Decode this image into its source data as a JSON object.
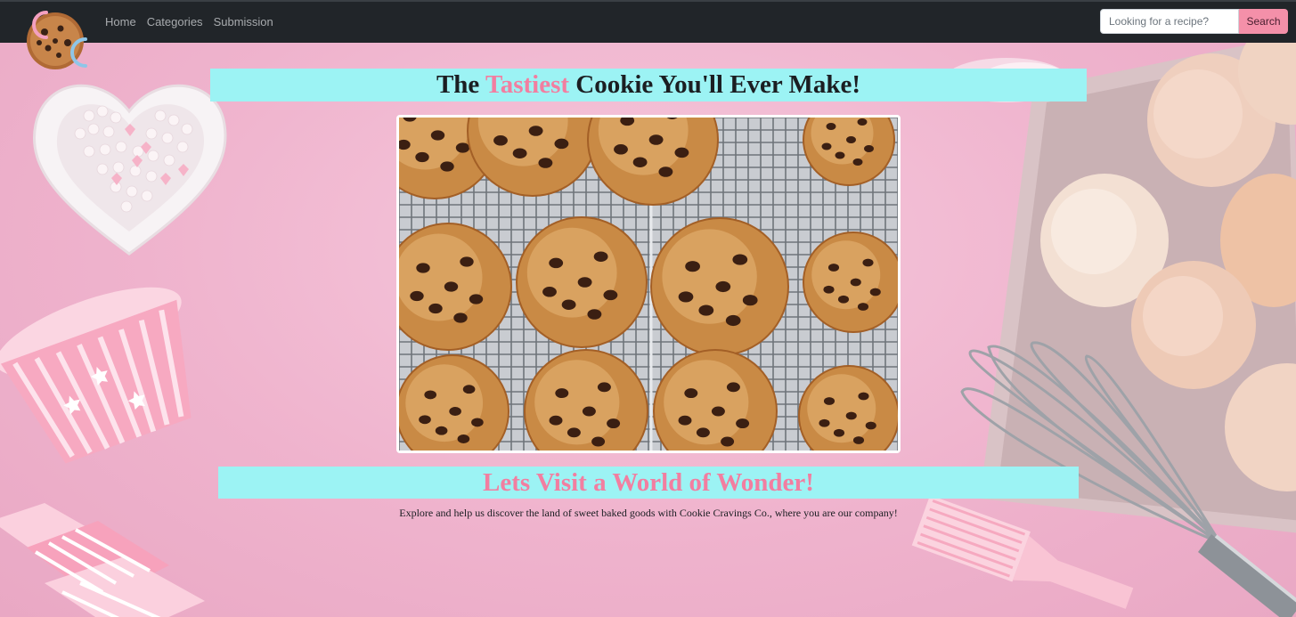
{
  "nav": {
    "links": [
      "Home",
      "Categories",
      "Submission"
    ]
  },
  "search": {
    "placeholder": "Looking for a recipe?",
    "button_label": "Search"
  },
  "hero": {
    "title_before": "The",
    "title_accent": "Tastiest",
    "title_after": "Cookie You'll Ever Make!",
    "subtitle": "Lets Visit a World of Wonder!",
    "tagline": "Explore and help us discover the land of sweet baked goods with Cookie Cravings Co., where you are our company!"
  },
  "colors": {
    "navbar": "#212529",
    "banner": "#9cf3f4",
    "accent_pink": "#f27ea0",
    "search_button": "#f490a9",
    "background": "#f2b9d3"
  },
  "icons": {
    "logo": "cookie-logo-icon"
  }
}
